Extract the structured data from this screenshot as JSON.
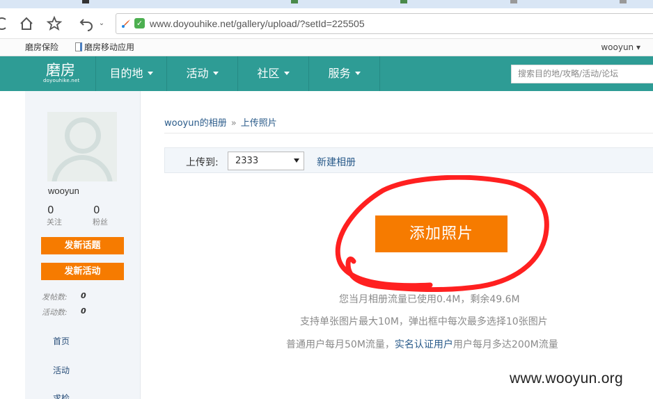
{
  "browser": {
    "url": "www.doyouhike.net/gallery/upload/?setId=225505",
    "bookmarks": [
      "磨房保险",
      "磨房移动应用"
    ],
    "bookmark_user": "wooyun ▾"
  },
  "site": {
    "logo_cn": "磨房",
    "logo_en": "doyouhike.net",
    "menu": [
      "目的地",
      "活动",
      "社区",
      "服务"
    ],
    "search_placeholder": "搜索目的地/攻略/活动/论坛"
  },
  "sidebar": {
    "username": "wooyun",
    "stats": [
      {
        "num": "0",
        "label": "关注"
      },
      {
        "num": "0",
        "label": "粉丝"
      }
    ],
    "buttons": [
      "发新话题",
      "发新活动"
    ],
    "counts": [
      {
        "label": "发帖数:",
        "value": "0"
      },
      {
        "label": "活动数:",
        "value": "0"
      }
    ],
    "links": [
      "首页",
      "活动",
      "求检"
    ]
  },
  "main": {
    "breadcrumb": [
      "wooyun的相册",
      "上传照片"
    ],
    "breadcrumb_sep": "»",
    "upload_label": "上传到:",
    "album_selected": "2333",
    "new_album": "新建相册",
    "add_photo": "添加照片",
    "info_1": "您当月相册流量已使用0.4M，剩余49.6M",
    "info_2": "支持单张图片最大10M，弹出框中每次最多选择10张图片",
    "info_3_pre": "普通用户每月50M流量，",
    "info_3_link": "实名认证用户",
    "info_3_post": "用户每月多达200M流量"
  },
  "watermark": "www.wooyun.org",
  "colors": {
    "header": "#2e9c95",
    "accent_orange": "#f67b00",
    "annotation_red": "#ff2020",
    "link_blue": "#2a5b8a"
  }
}
